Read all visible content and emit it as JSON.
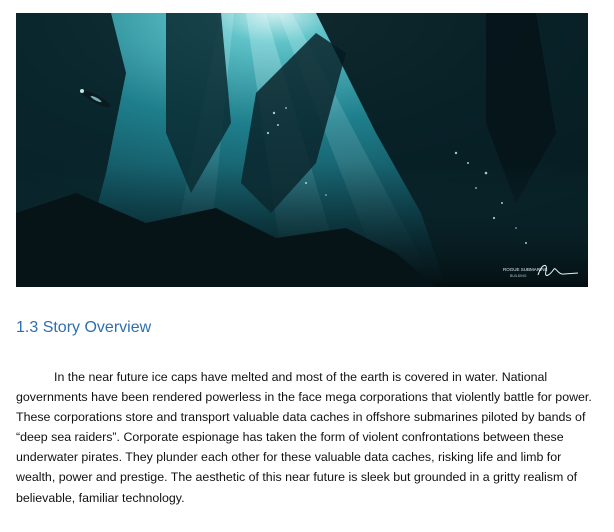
{
  "illustration": {
    "caption_line1": "ROGUE SUBMARINE",
    "caption_line2": "BUILDING",
    "signature": "signature-mark"
  },
  "section": {
    "heading": "1.3 Story Overview",
    "paragraph": "In the near future ice caps have melted and most of the earth is covered in water. National governments have been rendered powerless in the face mega corporations that violently battle for power. These corporations store and transport valuable data caches in offshore submarines piloted by bands of “deep sea raiders”. Corporate espionage has taken the form of violent confrontations between these underwater pirates. They plunder each other for these valuable data caches, risking life and limb for wealth, power and prestige. The aesthetic of this near future is sleek but grounded in a gritty realism of believable, familiar technology."
  },
  "colors": {
    "heading": "#2e6fb0",
    "text": "#111111",
    "water_light": "#2fa3b0",
    "water_dark": "#06181d"
  }
}
